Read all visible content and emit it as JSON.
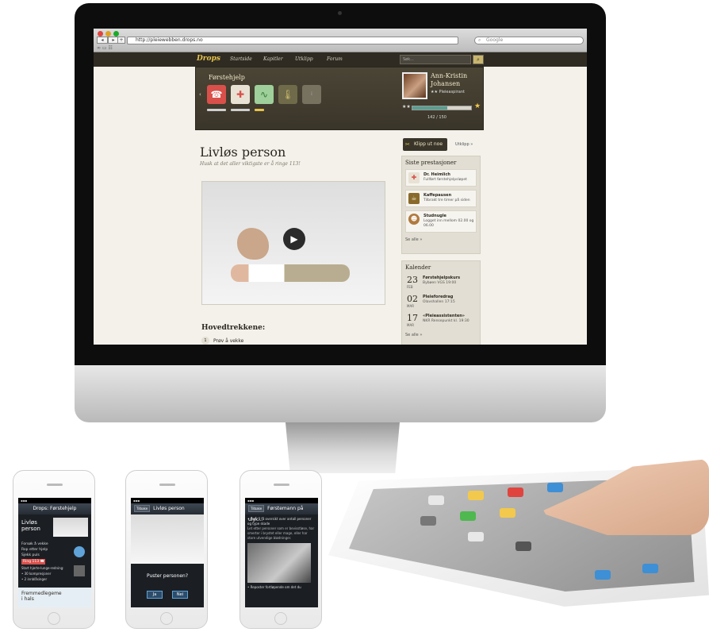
{
  "browser": {
    "url": "http://pleiewebben.drops.no",
    "search_placeholder": "Google"
  },
  "site": {
    "logo": "Drops",
    "nav": [
      "Startside",
      "Kapitler",
      "Utklipp",
      "Forum"
    ],
    "search_placeholder": "Søk..."
  },
  "dropdown": {
    "title": "Førstehjelp",
    "icons": [
      "phone-icon",
      "first-aid-kit-icon",
      "heartbeat-icon",
      "thermometer-icon",
      "info-icon"
    ],
    "colors": {
      "phone": "#d9504a",
      "kit": "#e8e2d4",
      "heart": "#9fcf9a",
      "therm": "#6f6a4a",
      "info": "#777160"
    }
  },
  "profile": {
    "name": "Ann-Kristin Johansen",
    "rank": "★★ Pleieaspirant",
    "xp_text": "142 / 150",
    "progress": 0.6
  },
  "main": {
    "title": "Livløs person",
    "subtitle": "Husk at det aller viktigste er å ringe 113!",
    "section_heading": "Hovedtrekkene:",
    "step_number": "1",
    "step_text": "Prøv å vekke"
  },
  "sidebar": {
    "clip_button": "Klipp ut noe",
    "clip_link": "Utklipp »",
    "achievements_title": "Siste prestasjoner",
    "achievements": [
      {
        "name": "Dr. Heimlich",
        "desc": "Fullført førstehjelpsløpet"
      },
      {
        "name": "Kaffepausen",
        "desc": "Tilbrakt tre timer på siden"
      },
      {
        "name": "Studnugle",
        "desc": "Logget inn mellom 02.00 og 06.00"
      }
    ],
    "see_all": "Se alle »",
    "calendar_title": "Kalender",
    "events": [
      {
        "day": "23",
        "month": "FEB",
        "title": "Førstehjelpskurs",
        "sub": "Bybøen VGS 19:00"
      },
      {
        "day": "02",
        "month": "MAR",
        "title": "Pleieforedrag",
        "sub": "Olavshallen 17:15"
      },
      {
        "day": "17",
        "month": "MAR",
        "title": "«Pleieassistenten»",
        "sub": "NKR Rensepunkt kl. 19:30"
      }
    ],
    "calendar_see_all": "Se alle »"
  },
  "phones": [
    {
      "header": "Drops: Førstehjelp",
      "hero": "Livløs person",
      "items": [
        "Forsøk å vekke",
        "Rop etter hjelp",
        "Sjekk puls",
        "Ring 113",
        "Start hjerte-lunge-redning:",
        "• 30 kompresjoner",
        "• 2 innblåsinger"
      ],
      "footer": "Fremmedlegeme i hals"
    },
    {
      "back": "Tilbake",
      "header": "Livløs person",
      "question": "Puster personen?",
      "yes": "Ja",
      "no": "Nei"
    },
    {
      "back": "Tilbake",
      "header": "Førstemann på ulyk...",
      "items": [
        "• Prøv å få oversikt over antall personer og type skade",
        "Let etter personer som er bevisstløse, har smerter i brystet eller mage, eller har store utvendige blødninger."
      ],
      "footer_item": "• Reposter fortløpende om det du"
    }
  ]
}
